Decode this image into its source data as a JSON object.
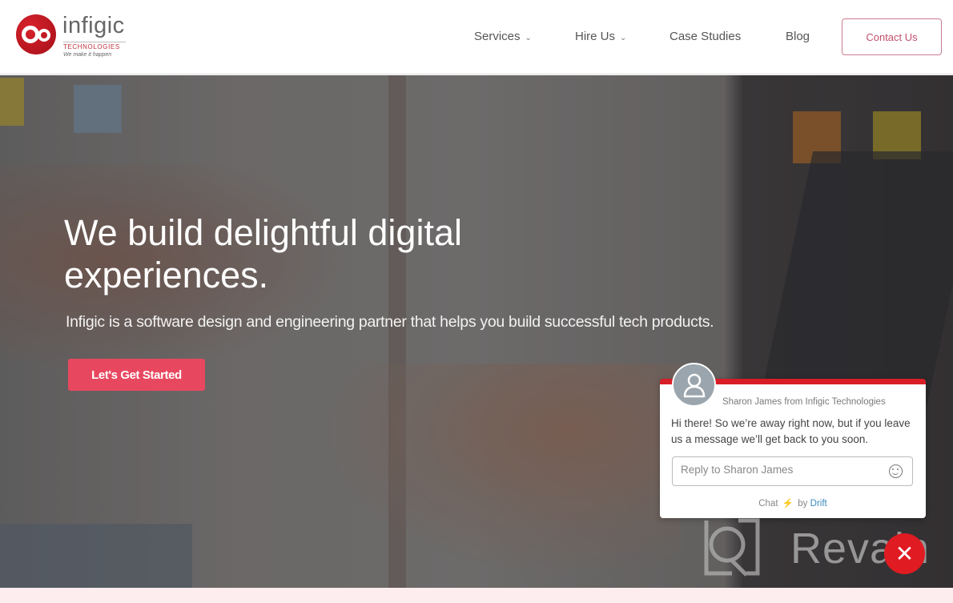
{
  "header": {
    "logo": {
      "name": "infigic",
      "subtitle": "TECHNOLOGIES",
      "tagline": "We make it happen"
    },
    "nav": [
      {
        "label": "Services",
        "has_dropdown": true
      },
      {
        "label": "Hire Us",
        "has_dropdown": true
      },
      {
        "label": "Case Studies",
        "has_dropdown": false
      },
      {
        "label": "Blog",
        "has_dropdown": false
      }
    ],
    "chevron": "⌄",
    "contact_label": "Contact Us"
  },
  "hero": {
    "title": "We build delightful digital experiences.",
    "subtitle": "Infigic is a software design and engineering partner that helps you build successful tech products.",
    "cta_label": "Let's Get Started"
  },
  "chat": {
    "from": "Sharon James from Infigic Technologies",
    "message": "Hi there! So we’re away right now, but if you leave us a message we’ll get back to you soon.",
    "reply_placeholder": "Reply to Sharon James",
    "footer_chat": "Chat",
    "footer_bolt": "⚡",
    "footer_by": "by",
    "footer_brand": "Drift",
    "close_symbol": "✕"
  },
  "watermark": {
    "text": "Revain"
  },
  "colors": {
    "brand_red": "#d81d27",
    "cta_pink": "#e8485f",
    "contact_border": "#c87d90",
    "drift_blue": "#3a8bbd"
  }
}
